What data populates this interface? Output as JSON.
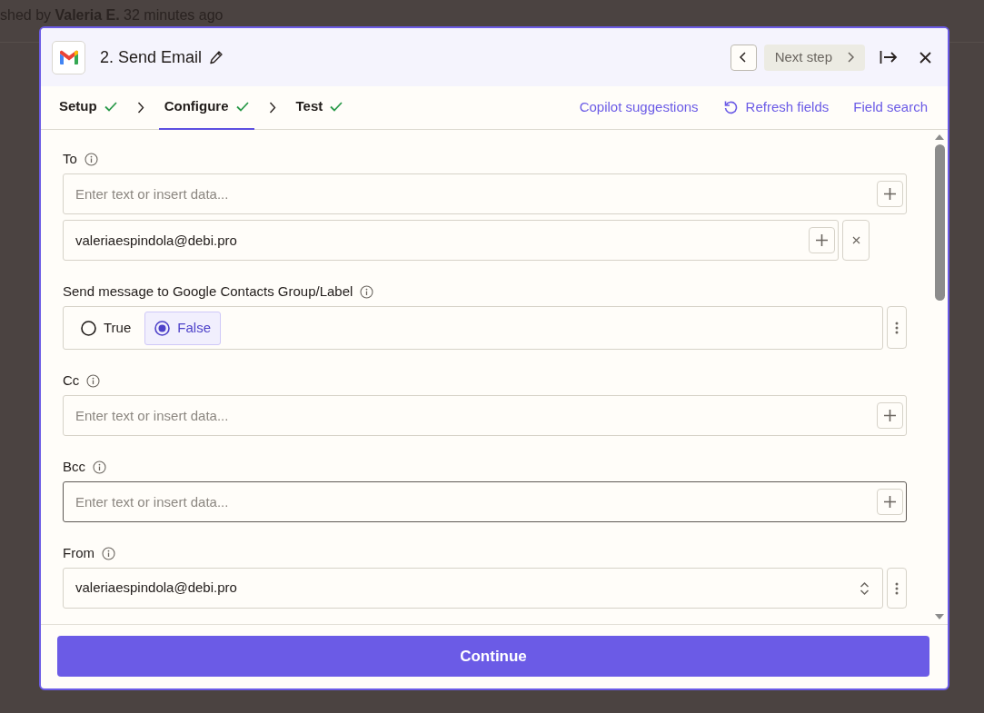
{
  "background": {
    "byline": "shed by **Valeria E.** 32 minutes ago"
  },
  "modal": {
    "title": "2. Send Email",
    "next_button": {
      "label": "Next step",
      "disabled": true
    },
    "steps": [
      {
        "label": "Setup",
        "done": true,
        "selected": false
      },
      {
        "label": "Configure",
        "done": true,
        "selected": true
      },
      {
        "label": "Test",
        "done": true,
        "selected": false
      }
    ],
    "actions": [
      {
        "label": "Copilot suggestions",
        "kind": "plain"
      },
      {
        "label": "Refresh fields",
        "kind": "refresh"
      },
      {
        "label": "Field search",
        "kind": "plain"
      }
    ],
    "fields": [
      {
        "kind": "text",
        "label": "To",
        "placeholder": "Enter text or insert data...",
        "focused": false,
        "values": [
          "valeriaespindola@debi.pro"
        ]
      },
      {
        "kind": "radio",
        "label": "Send message to Google Contacts Group/Label",
        "options": [
          {
            "label": "True",
            "selected": false
          },
          {
            "label": "False",
            "selected": true
          }
        ]
      },
      {
        "kind": "text",
        "label": "Cc",
        "placeholder": "Enter text or insert data...",
        "focused": false
      },
      {
        "kind": "text",
        "label": "Bcc",
        "placeholder": "Enter text or insert data...",
        "focused": true
      },
      {
        "kind": "select",
        "label": "From",
        "value": "valeriaespindola@debi.pro"
      }
    ],
    "continue_button": "Continue"
  }
}
